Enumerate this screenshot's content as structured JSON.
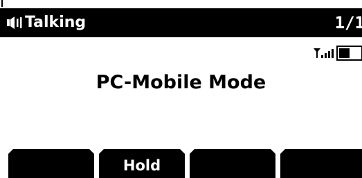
{
  "status_bar": {
    "state_label": "Talking",
    "page_counter": "1/1",
    "speaker_icon": "speaker-icon"
  },
  "indicators": {
    "signal_icon": "signal-strength-icon",
    "signal_bars": 4,
    "battery_icon": "battery-icon",
    "battery_level": 0.5
  },
  "main": {
    "title": "PC-Mobile Mode"
  },
  "softkeys": [
    {
      "label": ""
    },
    {
      "label": "Hold"
    },
    {
      "label": ""
    },
    {
      "label": ""
    }
  ],
  "colors": {
    "background": "#ffffff",
    "foreground": "#000000",
    "inverse_text": "#ffffff"
  }
}
